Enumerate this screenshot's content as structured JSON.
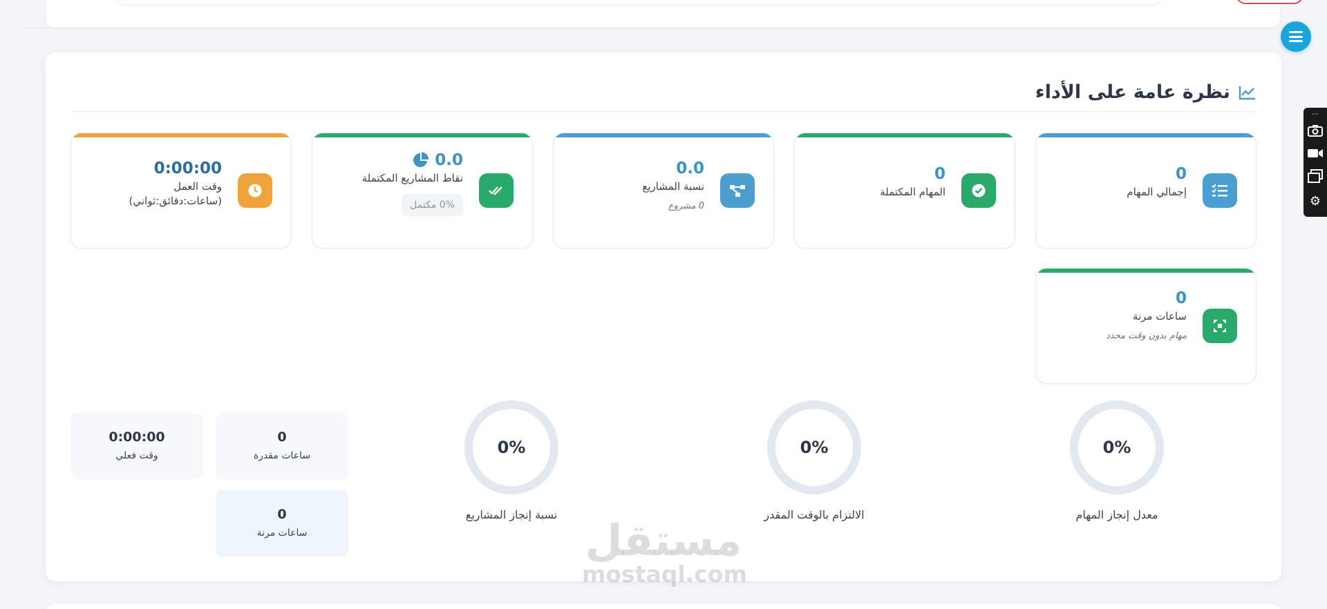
{
  "section": {
    "title": "نظرة عامة على الأداء"
  },
  "stats": {
    "total_tasks": {
      "value": "0",
      "label": "إجمالي المهام",
      "color": "#4a9fd0"
    },
    "completed_tasks": {
      "value": "0",
      "label": "المهام المكتملة",
      "color": "#2aaa6a"
    },
    "projects_ratio": {
      "value": "0.0",
      "label": "نسبة المشاريع",
      "note": "0 مشروع",
      "color": "#4a9fd0"
    },
    "completed_points": {
      "value": "0.0",
      "label": "نقاط المشاريع المكتملة",
      "note": "0% مكتمل",
      "color": "#2aaa6a"
    },
    "work_time": {
      "value": "0:00:00",
      "label": "وقت العمل",
      "sublabel": "(ساعات:دقائق:ثواني)",
      "color": "#f0a33b"
    },
    "flex_hours": {
      "value": "0",
      "label": "ساعات مرنة",
      "note": "مهام بدون وقت محدد",
      "color": "#2aaa6a"
    }
  },
  "circles": [
    {
      "value": "0%",
      "label": "معدل إنجاز المهام"
    },
    {
      "value": "0%",
      "label": "الالتزام بالوقت المقدر"
    },
    {
      "value": "0%",
      "label": "نسبة إنجاز المشاريع"
    }
  ],
  "mini": {
    "estimated": {
      "value": "0",
      "label": "ساعات مقدرة"
    },
    "actual": {
      "value": "0:00:00",
      "label": "وقت فعلي"
    },
    "flex": {
      "value": "0",
      "label": "ساعات مرنة"
    }
  },
  "watermark": {
    "ar": "مستقل",
    "en": "mostaql.com"
  }
}
